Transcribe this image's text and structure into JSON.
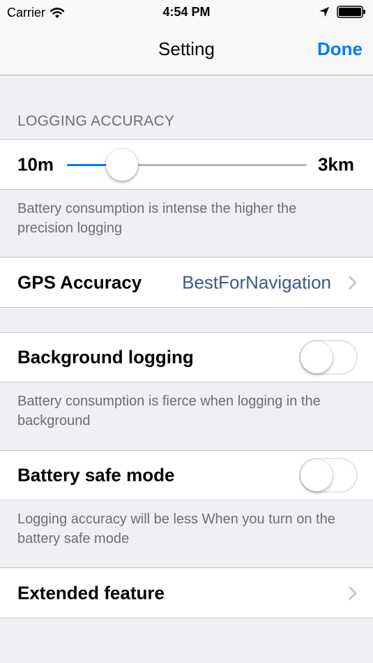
{
  "status_bar": {
    "carrier": "Carrier",
    "time": "4:54 PM"
  },
  "nav": {
    "title": "Setting",
    "done_label": "Done"
  },
  "logging_accuracy": {
    "header": "LOGGING ACCURACY",
    "min_label": "10m",
    "max_label": "3km",
    "slider_value_fraction": 0.23,
    "footer": "Battery consumption is intense the higher the precision logging"
  },
  "gps_accuracy": {
    "label": "GPS Accuracy",
    "value": "BestForNavigation"
  },
  "background_logging": {
    "label": "Background logging",
    "enabled": false,
    "footer": "Battery consumption is fierce when logging in the background"
  },
  "battery_safe_mode": {
    "label": "Battery safe mode",
    "enabled": false,
    "footer": "Logging accuracy will be less When you turn on the battery safe mode"
  },
  "extended_feature": {
    "label": "Extended feature"
  },
  "colors": {
    "accent": "#007aff",
    "value_text": "#3c5a8a",
    "background": "#efeff4",
    "secondary_text": "#6d6d72"
  },
  "icons": {
    "wifi": "wifi-icon",
    "location": "location-arrow-icon",
    "battery": "battery-icon",
    "chevron": "chevron-right-icon"
  }
}
